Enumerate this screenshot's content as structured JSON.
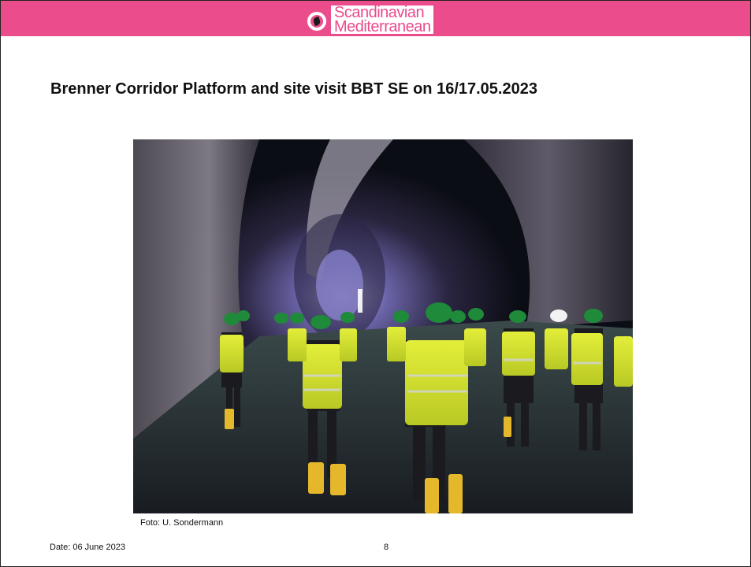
{
  "brand": {
    "line1": "Scandinavian",
    "line2": "Mediterranean",
    "bar_color": "#ea4c8c"
  },
  "title": "Brenner Corridor Platform and site visit BBT SE on 16/17.05.2023",
  "photo": {
    "icon": "tunnel-photo"
  },
  "caption": "Foto: U. Sondermann",
  "footer": {
    "date": "Date: 06 June 2023",
    "page": "8"
  }
}
